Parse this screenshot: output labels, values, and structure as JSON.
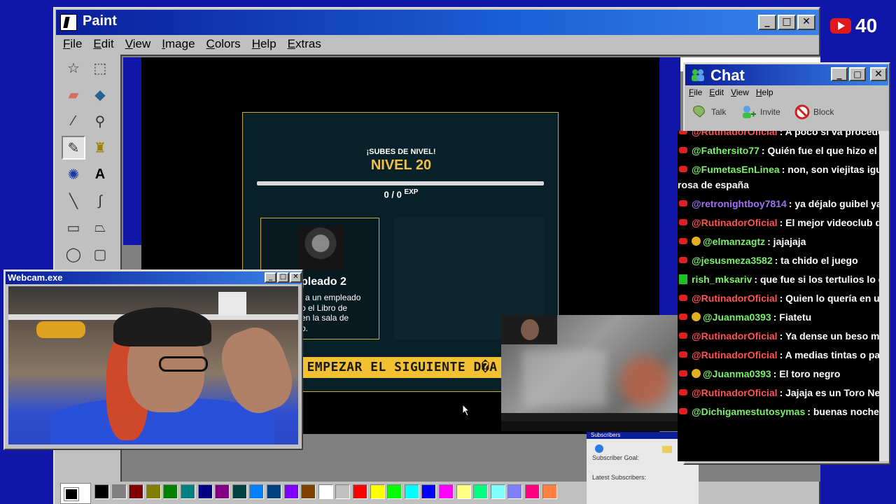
{
  "paint": {
    "title": "Paint",
    "menu": [
      "File",
      "Edit",
      "View",
      "Image",
      "Colors",
      "Help",
      "Extras"
    ],
    "tools": [
      "free-select",
      "rect-select",
      "eraser",
      "fill",
      "color-picker",
      "magnifier",
      "pencil",
      "brush",
      "airbrush",
      "text",
      "line",
      "curve",
      "rectangle",
      "polygon",
      "ellipse",
      "rounded-rectangle"
    ],
    "palette": [
      "#000000",
      "#808080",
      "#800000",
      "#808000",
      "#008000",
      "#008080",
      "#000080",
      "#800080",
      "#004040",
      "#0080ff",
      "#004080",
      "#8000ff",
      "#804000",
      "#ffffff",
      "#c0c0c0",
      "#ff0000",
      "#ffff00",
      "#00ff00",
      "#00ffff",
      "#0000ff",
      "#ff00ff",
      "#ffff80",
      "#00ff80",
      "#80ffff",
      "#8080ff",
      "#ff0080",
      "#ff8040"
    ]
  },
  "game": {
    "subtitle": "¡SUBES DE NIVEL!",
    "level": "NIVEL 20",
    "xp_value": "0 / 0",
    "xp_unit": "EXP",
    "card_title": "pleado 2",
    "card_desc_lines": [
      "a un empleado",
      "o el Libro de",
      "en la sala de",
      "o."
    ],
    "next_button": "EMPEZAR EL SIGUIENTE D�A"
  },
  "webcam": {
    "title": "Webcam.exe"
  },
  "chat": {
    "title": "Chat",
    "menu": [
      "File",
      "Edit",
      "View",
      "Help"
    ],
    "toolbar": [
      "Talk",
      "Invite",
      "Block"
    ],
    "messages": [
      {
        "user": "@RutinadorOficial",
        "text": ": A poco si va proceder la",
        "color": "#ff5252",
        "badge": "yt"
      },
      {
        "user": "@Fathersito77",
        "text": ": Quién fue el que hizo el Vide",
        "color": "#7cf06c",
        "badge": "yt"
      },
      {
        "user": "@FumetasEnLinea",
        "text": ": non, son viejitas iguales",
        "color": "#7cf06c",
        "badge": "yt",
        "cont": "rosa de españa"
      },
      {
        "user": "@retronightboy7814",
        "text": ": ya déjalo guibel ya es",
        "color": "#a070f0",
        "badge": "yt"
      },
      {
        "user": "@RutinadorOficial",
        "text": ": El mejor videoclub de la",
        "color": "#ff5252",
        "badge": "yt"
      },
      {
        "user": "@elmanzagtz",
        "text": ": jajajaja",
        "color": "#7cf06c",
        "badge": "yt",
        "mod": true
      },
      {
        "user": "@jesusmeza3582",
        "text": ": ta chido el juego",
        "color": "#7cf06c",
        "badge": "yt"
      },
      {
        "user": "rish_mksariv",
        "text": ": que fue si los tertulios lo dice",
        "color": "#7cf06c",
        "badge": "kick"
      },
      {
        "user": "@RutinadorOficial",
        "text": ": Quien lo quería en un pr",
        "color": "#ff5252",
        "badge": "yt"
      },
      {
        "user": "@Juanma0393",
        "text": ": Fiatetu",
        "color": "#7cf06c",
        "badge": "yt",
        "mod": true
      },
      {
        "user": "@RutinadorOficial",
        "text": ": Ya dense un beso mejor",
        "color": "#ff5252",
        "badge": "yt"
      },
      {
        "user": "@RutinadorOficial",
        "text": ": A medias tintas o pacta",
        "color": "#ff5252",
        "badge": "yt"
      },
      {
        "user": "@Juanma0393",
        "text": ": El toro negro",
        "color": "#7cf06c",
        "badge": "yt",
        "mod": true
      },
      {
        "user": "@RutinadorOficial",
        "text": ": Jajaja es un Toro Negro",
        "color": "#ff5252",
        "badge": "yt"
      },
      {
        "user": "@Dichigamestutosymas",
        "text": ": buenas noches ta",
        "color": "#7cf06c",
        "badge": "yt"
      }
    ]
  },
  "youtube": {
    "count": "40"
  },
  "subscribers": {
    "title": "Subscribers",
    "goal_label": "Subscriber Goal:",
    "latest_label": "Latest Subscribers:"
  }
}
